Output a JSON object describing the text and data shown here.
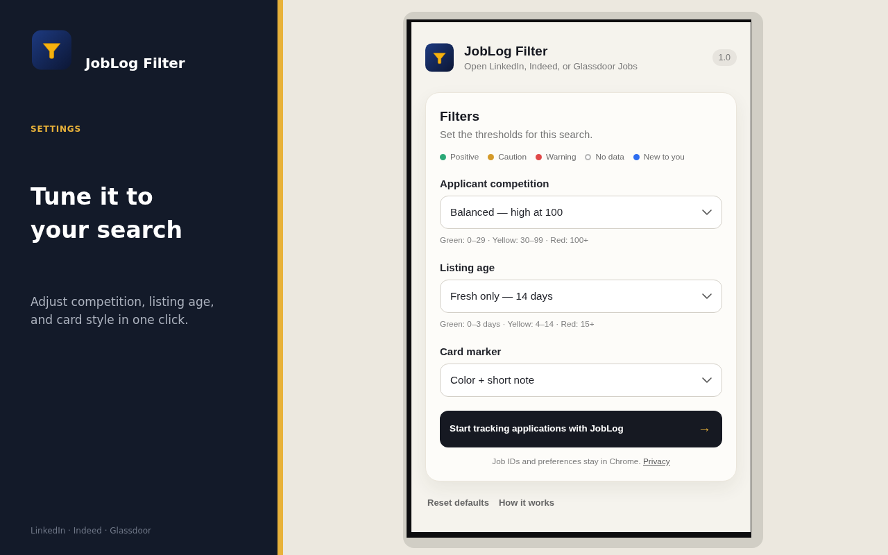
{
  "sidebar": {
    "app_name": "JobLog Filter",
    "eyebrow": "SETTINGS",
    "headline": "Tune it to your search",
    "description": "Adjust competition, listing age, and card style in one click.",
    "footer": "LinkedIn · Indeed · Glassdoor"
  },
  "popup": {
    "title": "JobLog Filter",
    "subtitle": "Open LinkedIn, Indeed, or Glassdoor Jobs",
    "version": "1.0",
    "filters_card": {
      "title": "Filters",
      "description": "Set the thresholds for this search.",
      "legend": [
        {
          "label": "Positive",
          "kind": "filled",
          "color": "#2aa876"
        },
        {
          "label": "Caution",
          "kind": "filled",
          "color": "#d49a29"
        },
        {
          "label": "Warning",
          "kind": "filled",
          "color": "#e04848"
        },
        {
          "label": "No data",
          "kind": "hollow",
          "color": "#b5b5b5"
        },
        {
          "label": "New to you",
          "kind": "filled",
          "color": "#2d6df0"
        }
      ],
      "fields": [
        {
          "label": "Applicant competition",
          "value": "Balanced — high at 100",
          "hint": "Green: 0–29 · Yellow: 30–99 · Red: 100+"
        },
        {
          "label": "Listing age",
          "value": "Fresh only — 14 days",
          "hint": "Green: 0–3 days · Yellow: 4–14 · Red: 15+"
        },
        {
          "label": "Card marker",
          "value": "Color + short note"
        }
      ],
      "primary_button": {
        "label": "Start tracking applications with JobLog",
        "arrow": "→"
      },
      "footnote": {
        "text": "Job IDs and preferences stay in Chrome.",
        "link": "Privacy"
      }
    },
    "footer_links": [
      "Reset defaults",
      "How it works"
    ]
  }
}
